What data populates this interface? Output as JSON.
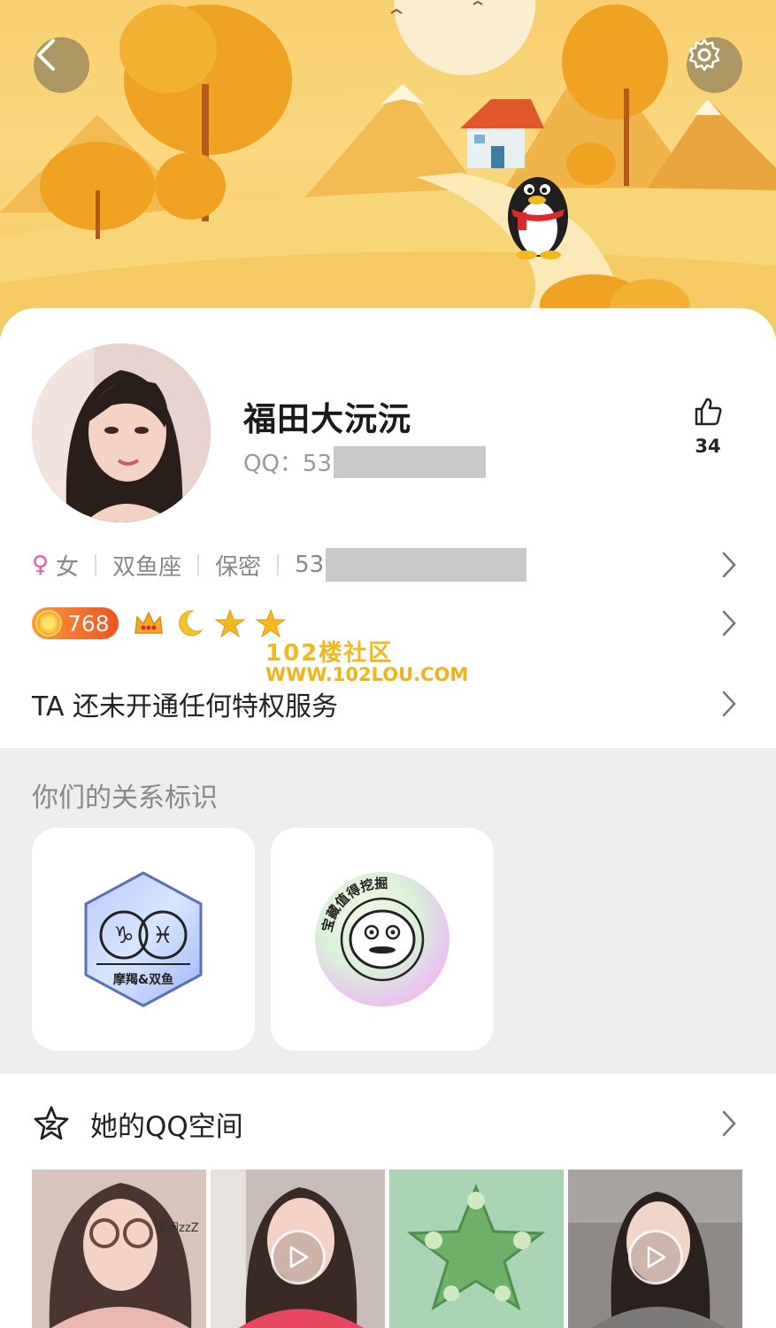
{
  "profile": {
    "nickname": "福田大沅沅",
    "qq_prefix": "QQ：53",
    "likes": "34"
  },
  "info": {
    "gender_symbol": "♀",
    "gender": "女",
    "zodiac": "双鱼座",
    "privacy": "保密",
    "extra_prefix": "53"
  },
  "level": {
    "coin_value": "768"
  },
  "privilege": {
    "text": "TA 还未开通任何特权服务"
  },
  "watermark": {
    "line1": "102楼社区",
    "line2": "WWW.102LOU.COM"
  },
  "relation": {
    "title": "你们的关系标识",
    "badge1_label": "摩羯&双鱼",
    "badge2_label": "宝藏值得挖掘"
  },
  "qzone": {
    "title": "她的QQ空间",
    "photos": [
      {
        "kind": "image",
        "caption": "困困zzZ"
      },
      {
        "kind": "video"
      },
      {
        "kind": "image"
      },
      {
        "kind": "video"
      }
    ]
  },
  "colors": {
    "banner_yellow": "#f7cf6e",
    "tree_orange": "#f0a320",
    "coin_orange": "#f0521f",
    "female_pink": "#e85aa5",
    "star_gold": "#f5b81a"
  }
}
